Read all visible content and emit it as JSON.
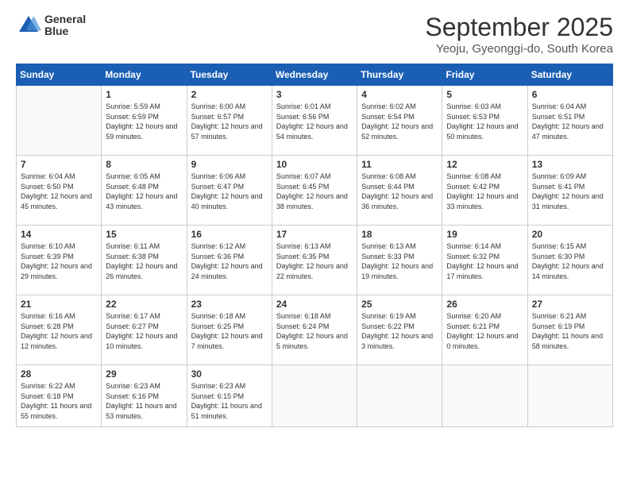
{
  "logo": {
    "general": "General",
    "blue": "Blue"
  },
  "header": {
    "month_year": "September 2025",
    "location": "Yeoju, Gyeonggi-do, South Korea"
  },
  "weekdays": [
    "Sunday",
    "Monday",
    "Tuesday",
    "Wednesday",
    "Thursday",
    "Friday",
    "Saturday"
  ],
  "weeks": [
    [
      {
        "day": "",
        "empty": true
      },
      {
        "day": "1",
        "sunrise": "Sunrise: 5:59 AM",
        "sunset": "Sunset: 6:59 PM",
        "daylight": "Daylight: 12 hours and 59 minutes."
      },
      {
        "day": "2",
        "sunrise": "Sunrise: 6:00 AM",
        "sunset": "Sunset: 6:57 PM",
        "daylight": "Daylight: 12 hours and 57 minutes."
      },
      {
        "day": "3",
        "sunrise": "Sunrise: 6:01 AM",
        "sunset": "Sunset: 6:56 PM",
        "daylight": "Daylight: 12 hours and 54 minutes."
      },
      {
        "day": "4",
        "sunrise": "Sunrise: 6:02 AM",
        "sunset": "Sunset: 6:54 PM",
        "daylight": "Daylight: 12 hours and 52 minutes."
      },
      {
        "day": "5",
        "sunrise": "Sunrise: 6:03 AM",
        "sunset": "Sunset: 6:53 PM",
        "daylight": "Daylight: 12 hours and 50 minutes."
      },
      {
        "day": "6",
        "sunrise": "Sunrise: 6:04 AM",
        "sunset": "Sunset: 6:51 PM",
        "daylight": "Daylight: 12 hours and 47 minutes."
      }
    ],
    [
      {
        "day": "7",
        "sunrise": "Sunrise: 6:04 AM",
        "sunset": "Sunset: 6:50 PM",
        "daylight": "Daylight: 12 hours and 45 minutes."
      },
      {
        "day": "8",
        "sunrise": "Sunrise: 6:05 AM",
        "sunset": "Sunset: 6:48 PM",
        "daylight": "Daylight: 12 hours and 43 minutes."
      },
      {
        "day": "9",
        "sunrise": "Sunrise: 6:06 AM",
        "sunset": "Sunset: 6:47 PM",
        "daylight": "Daylight: 12 hours and 40 minutes."
      },
      {
        "day": "10",
        "sunrise": "Sunrise: 6:07 AM",
        "sunset": "Sunset: 6:45 PM",
        "daylight": "Daylight: 12 hours and 38 minutes."
      },
      {
        "day": "11",
        "sunrise": "Sunrise: 6:08 AM",
        "sunset": "Sunset: 6:44 PM",
        "daylight": "Daylight: 12 hours and 36 minutes."
      },
      {
        "day": "12",
        "sunrise": "Sunrise: 6:08 AM",
        "sunset": "Sunset: 6:42 PM",
        "daylight": "Daylight: 12 hours and 33 minutes."
      },
      {
        "day": "13",
        "sunrise": "Sunrise: 6:09 AM",
        "sunset": "Sunset: 6:41 PM",
        "daylight": "Daylight: 12 hours and 31 minutes."
      }
    ],
    [
      {
        "day": "14",
        "sunrise": "Sunrise: 6:10 AM",
        "sunset": "Sunset: 6:39 PM",
        "daylight": "Daylight: 12 hours and 29 minutes."
      },
      {
        "day": "15",
        "sunrise": "Sunrise: 6:11 AM",
        "sunset": "Sunset: 6:38 PM",
        "daylight": "Daylight: 12 hours and 26 minutes."
      },
      {
        "day": "16",
        "sunrise": "Sunrise: 6:12 AM",
        "sunset": "Sunset: 6:36 PM",
        "daylight": "Daylight: 12 hours and 24 minutes."
      },
      {
        "day": "17",
        "sunrise": "Sunrise: 6:13 AM",
        "sunset": "Sunset: 6:35 PM",
        "daylight": "Daylight: 12 hours and 22 minutes."
      },
      {
        "day": "18",
        "sunrise": "Sunrise: 6:13 AM",
        "sunset": "Sunset: 6:33 PM",
        "daylight": "Daylight: 12 hours and 19 minutes."
      },
      {
        "day": "19",
        "sunrise": "Sunrise: 6:14 AM",
        "sunset": "Sunset: 6:32 PM",
        "daylight": "Daylight: 12 hours and 17 minutes."
      },
      {
        "day": "20",
        "sunrise": "Sunrise: 6:15 AM",
        "sunset": "Sunset: 6:30 PM",
        "daylight": "Daylight: 12 hours and 14 minutes."
      }
    ],
    [
      {
        "day": "21",
        "sunrise": "Sunrise: 6:16 AM",
        "sunset": "Sunset: 6:28 PM",
        "daylight": "Daylight: 12 hours and 12 minutes."
      },
      {
        "day": "22",
        "sunrise": "Sunrise: 6:17 AM",
        "sunset": "Sunset: 6:27 PM",
        "daylight": "Daylight: 12 hours and 10 minutes."
      },
      {
        "day": "23",
        "sunrise": "Sunrise: 6:18 AM",
        "sunset": "Sunset: 6:25 PM",
        "daylight": "Daylight: 12 hours and 7 minutes."
      },
      {
        "day": "24",
        "sunrise": "Sunrise: 6:18 AM",
        "sunset": "Sunset: 6:24 PM",
        "daylight": "Daylight: 12 hours and 5 minutes."
      },
      {
        "day": "25",
        "sunrise": "Sunrise: 6:19 AM",
        "sunset": "Sunset: 6:22 PM",
        "daylight": "Daylight: 12 hours and 3 minutes."
      },
      {
        "day": "26",
        "sunrise": "Sunrise: 6:20 AM",
        "sunset": "Sunset: 6:21 PM",
        "daylight": "Daylight: 12 hours and 0 minutes."
      },
      {
        "day": "27",
        "sunrise": "Sunrise: 6:21 AM",
        "sunset": "Sunset: 6:19 PM",
        "daylight": "Daylight: 11 hours and 58 minutes."
      }
    ],
    [
      {
        "day": "28",
        "sunrise": "Sunrise: 6:22 AM",
        "sunset": "Sunset: 6:18 PM",
        "daylight": "Daylight: 11 hours and 55 minutes."
      },
      {
        "day": "29",
        "sunrise": "Sunrise: 6:23 AM",
        "sunset": "Sunset: 6:16 PM",
        "daylight": "Daylight: 11 hours and 53 minutes."
      },
      {
        "day": "30",
        "sunrise": "Sunrise: 6:23 AM",
        "sunset": "Sunset: 6:15 PM",
        "daylight": "Daylight: 11 hours and 51 minutes."
      },
      {
        "day": "",
        "empty": true
      },
      {
        "day": "",
        "empty": true
      },
      {
        "day": "",
        "empty": true
      },
      {
        "day": "",
        "empty": true
      }
    ]
  ]
}
